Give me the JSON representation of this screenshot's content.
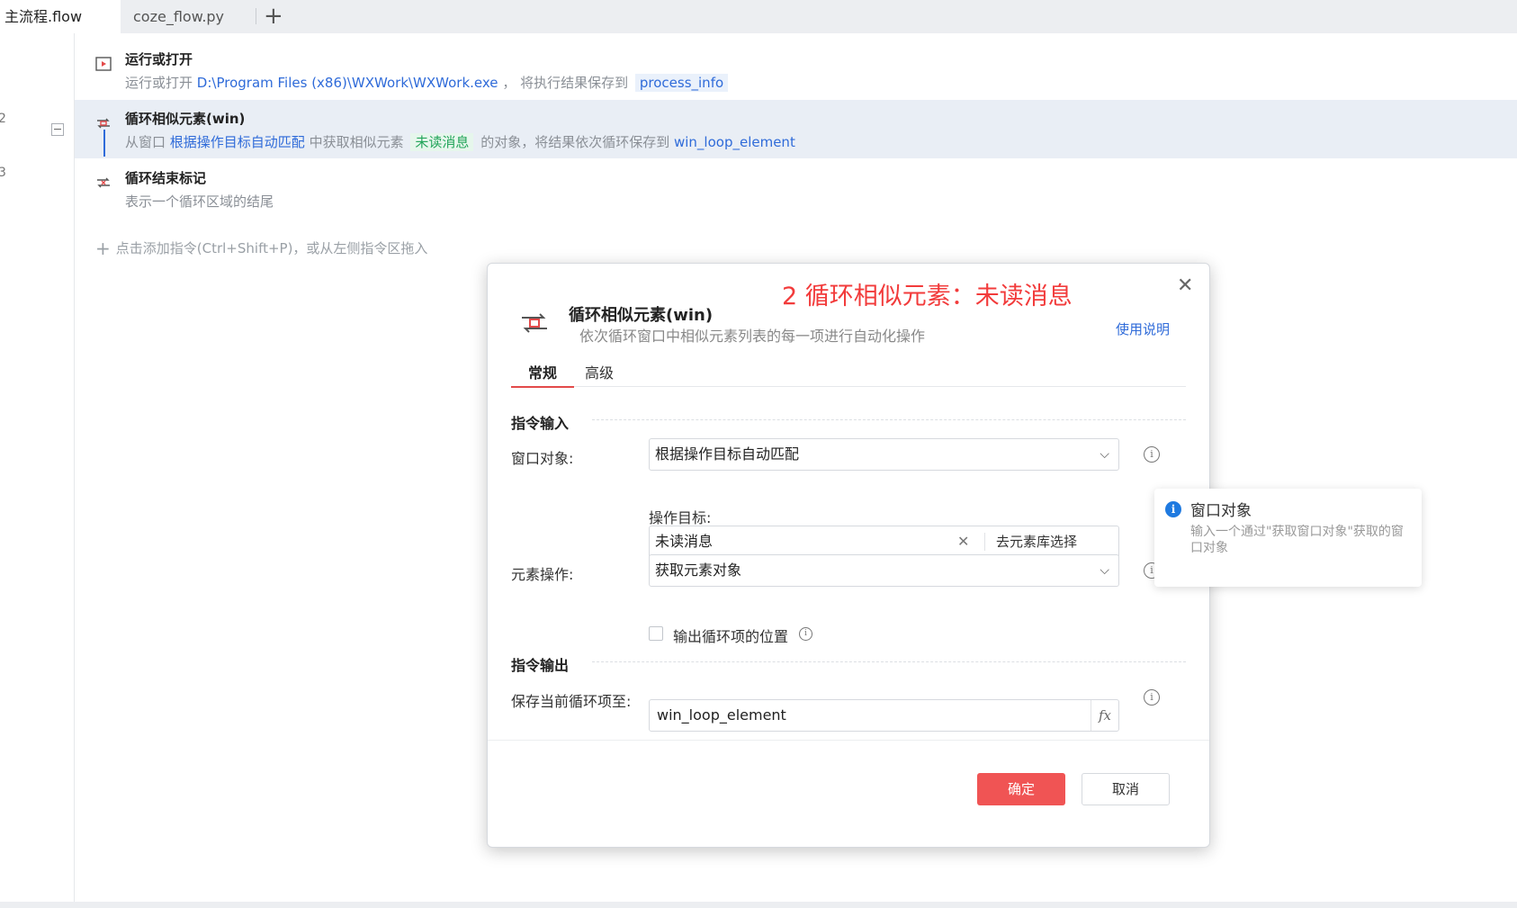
{
  "tabs": [
    {
      "label": "主流程.flow",
      "active": true
    },
    {
      "label": "coze_flow.py",
      "active": false
    }
  ],
  "tab_add_icon": "plus-icon",
  "gutter": {
    "numbers": [
      "2",
      "3"
    ]
  },
  "rows": [
    {
      "icon": "run-app-icon",
      "title": "运行或打开",
      "desc_prefix": "运行或打开",
      "path": "D:\\Program Files (x86)\\WXWork\\WXWork.exe",
      "desc_mid": "，  将执行结果保存到",
      "var": "process_info"
    },
    {
      "icon": "loop-element-icon",
      "title": "循环相似元素(win)",
      "desc_prefix": "从窗口",
      "window": "根据操作目标自动匹配",
      "desc_mid": "中获取相似元素",
      "target": "未读消息",
      "desc_mid2": "的对象，将结果依次循环保存到",
      "var": "win_loop_element"
    },
    {
      "icon": "loop-end-icon",
      "title": "循环结束标记",
      "desc": "表示一个循环区域的结尾"
    }
  ],
  "add_hint": "点击添加指令(Ctrl+Shift+P)，或从左侧指令区拖入",
  "dialog": {
    "annotation": "2 循环相似元素：未读消息",
    "title": "循环相似元素(win)",
    "subtitle": "依次循环窗口中相似元素列表的每一项进行自动化操作",
    "help": "使用说明",
    "tabs": [
      "常规",
      "高级"
    ],
    "section_input": "指令输入",
    "window_label": "窗口对象:",
    "window_value": "根据操作目标自动匹配",
    "target_label": "操作目标:",
    "target_value": "未读消息",
    "target_lib": "去元素库选择",
    "op_label": "元素操作:",
    "op_value": "获取元素对象",
    "checkbox_label": "输出循环项的位置",
    "checkbox_checked": false,
    "section_output": "指令输出",
    "save_label": "保存当前循环项至:",
    "save_value": "win_loop_element",
    "fx": "fx",
    "ok": "确定",
    "cancel": "取消"
  },
  "tooltip": {
    "title": "窗口对象",
    "body": "输入一个通过\"获取窗口对象\"获取的窗口对象"
  },
  "colors": {
    "accent_red": "#f05454",
    "link_blue": "#2f6bd9",
    "target_green": "#23a55a",
    "annotation_red": "#f23b3b",
    "selected_row": "#e9eef5"
  }
}
